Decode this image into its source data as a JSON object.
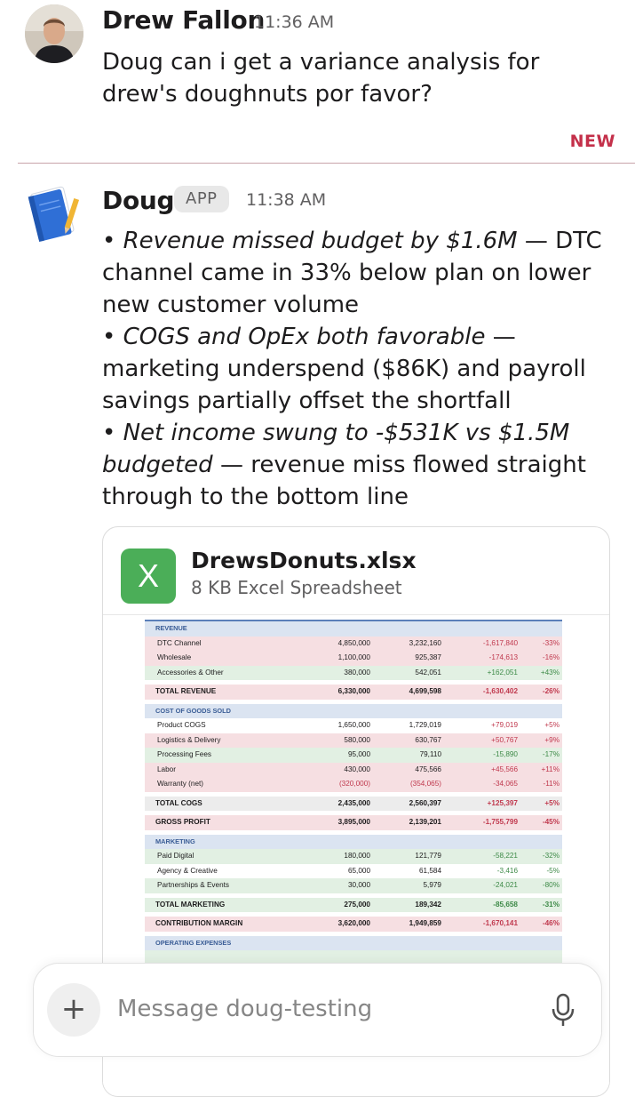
{
  "messages": [
    {
      "author": "Drew Fallon",
      "time": "11:36 AM",
      "text": "Doug can i get a variance analysis for drew's doughnuts por favor?"
    },
    {
      "author": "Doug",
      "badge": "APP",
      "time": "11:38 AM",
      "bullets": [
        {
          "italic": "Revenue missed budget by $1.6M",
          "rest": " — DTC channel came in 33% below plan on lower new customer volume"
        },
        {
          "italic": "COGS and OpEx both favorable",
          "rest": " — marketing underspend ($86K) and payroll savings partially offset the shortfall"
        },
        {
          "italic": "Net income swung to -$531K vs $1.5M budgeted",
          "rest": " — revenue miss flowed straight through to the bottom line"
        }
      ],
      "attachment": {
        "icon_letter": "X",
        "icon_name": "excel-icon",
        "file_name": "DrewsDonuts.xlsx",
        "file_meta": "8 KB Excel Spreadsheet"
      }
    }
  ],
  "divider": {
    "label": "NEW",
    "color": "#c4304a"
  },
  "sheet": {
    "sections": {
      "revenue": "REVENUE",
      "cogs": "COST OF GOODS SOLD",
      "marketing": "MARKETING",
      "opex": "OPERATING EXPENSES"
    },
    "rows": [
      {
        "label": "DTC Channel",
        "budget": "4,850,000",
        "actual": "3,232,160",
        "variance": "-1,617,840",
        "pct": "-33%"
      },
      {
        "label": "Wholesale",
        "budget": "1,100,000",
        "actual": "925,387",
        "variance": "-174,613",
        "pct": "-16%"
      },
      {
        "label": "Accessories & Other",
        "budget": "380,000",
        "actual": "542,051",
        "variance": "+162,051",
        "pct": "+43%"
      },
      {
        "label": "TOTAL REVENUE",
        "budget": "6,330,000",
        "actual": "4,699,598",
        "variance": "-1,630,402",
        "pct": "-26%"
      },
      {
        "label": "Product COGS",
        "budget": "1,650,000",
        "actual": "1,729,019",
        "variance": "+79,019",
        "pct": "+5%"
      },
      {
        "label": "Logistics & Delivery",
        "budget": "580,000",
        "actual": "630,767",
        "variance": "+50,767",
        "pct": "+9%"
      },
      {
        "label": "Processing Fees",
        "budget": "95,000",
        "actual": "79,110",
        "variance": "-15,890",
        "pct": "-17%"
      },
      {
        "label": "Labor",
        "budget": "430,000",
        "actual": "475,566",
        "variance": "+45,566",
        "pct": "+11%"
      },
      {
        "label": "Warranty (net)",
        "budget": "(320,000)",
        "actual": "(354,065)",
        "variance": "-34,065",
        "pct": "-11%"
      },
      {
        "label": "TOTAL COGS",
        "budget": "2,435,000",
        "actual": "2,560,397",
        "variance": "+125,397",
        "pct": "+5%"
      },
      {
        "label": "GROSS PROFIT",
        "budget": "3,895,000",
        "actual": "2,139,201",
        "variance": "-1,755,799",
        "pct": "-45%"
      },
      {
        "label": "Paid Digital",
        "budget": "180,000",
        "actual": "121,779",
        "variance": "-58,221",
        "pct": "-32%"
      },
      {
        "label": "Agency & Creative",
        "budget": "65,000",
        "actual": "61,584",
        "variance": "-3,416",
        "pct": "-5%"
      },
      {
        "label": "Partnerships & Events",
        "budget": "30,000",
        "actual": "5,979",
        "variance": "-24,021",
        "pct": "-80%"
      },
      {
        "label": "TOTAL MARKETING",
        "budget": "275,000",
        "actual": "189,342",
        "variance": "-85,658",
        "pct": "-31%"
      },
      {
        "label": "CONTRIBUTION MARGIN",
        "budget": "3,620,000",
        "actual": "1,949,859",
        "variance": "-1,670,141",
        "pct": "-46%"
      }
    ]
  },
  "composer": {
    "placeholder": "Message doug-testing"
  }
}
